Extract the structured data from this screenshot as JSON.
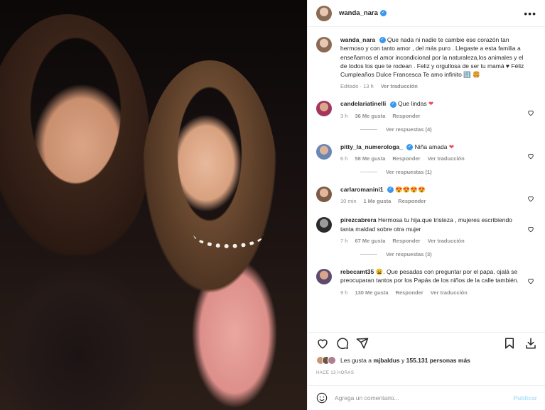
{
  "colors": {
    "verified": "#3897f0",
    "heart_red": "#ed4956",
    "secondary": "#8e8e8e",
    "post_disabled": "#b2dffc"
  },
  "header": {
    "username": "wanda_nara",
    "more_icon": "more-horizontal-icon"
  },
  "caption": {
    "username": "wanda_nara",
    "text": "Que nada ni nadie te cambie ese corazón tan hermoso y con tanto amor , del más puro . Llegaste a esta familia a enseñarnos el amor incondicional por la naturaleza,los animales y el de todos los que te rodean . Feliz y orgullosa de ser tu mamá ♥ Féliz Cumpleaños Dulce Francesca Te amo infinito 🔢 🍔",
    "time": "Editado · 13 h",
    "translate": "Ver traducción"
  },
  "comments": [
    {
      "username": "candelariatinelli",
      "verified": true,
      "text": "Que lindas",
      "emoji": "❤",
      "time": "3 h",
      "likes": "36 Me gusta",
      "reply": "Responder",
      "translate": "",
      "replies": "Ver respuestas (4)"
    },
    {
      "username": "pitty_la_numerologa_",
      "verified": true,
      "text": "Niña amada",
      "emoji": "❤",
      "time": "6 h",
      "likes": "58 Me gusta",
      "reply": "Responder",
      "translate": "Ver traducción",
      "replies": "Ver respuestas (1)"
    },
    {
      "username": "carlaromanini1",
      "verified": true,
      "text": "",
      "emoji": "😍😍😍😍",
      "time": "10 min",
      "likes": "1 Me gusta",
      "reply": "Responder",
      "translate": "",
      "replies": ""
    },
    {
      "username": "pirezcabrera",
      "verified": false,
      "text": "Hermosa tu hija.que tristeza , mujeres escribiendo tanta maldad sobre otra mujer",
      "emoji": "",
      "time": "7 h",
      "likes": "67 Me gusta",
      "reply": "Responder",
      "translate": "Ver traducción",
      "replies": "Ver respuestas (3)"
    },
    {
      "username": "rebecamt35",
      "verified": false,
      "text": "😩. Que pesadas con preguntar por el papa. ojalá se preocuparan tantos por los Papás de los niños de la calle también.",
      "emoji": "",
      "time": "9 h",
      "likes": "130 Me gusta",
      "reply": "Responder",
      "translate": "Ver traducción",
      "replies": ""
    }
  ],
  "actions": {
    "like_icon": "heart-icon",
    "comment_icon": "comment-icon",
    "share_icon": "share-icon",
    "save_icon": "bookmark-icon",
    "download_icon": "download-icon"
  },
  "likes": {
    "prefix": "Les gusta a",
    "user": "mjbaldus",
    "middle": "y",
    "count": "155.131 personas más"
  },
  "posted_ago": "HACE 13 HORAS",
  "compose": {
    "placeholder": "Agrega un comentario...",
    "post_label": "Publicar",
    "emoji_icon": "smiley-icon"
  }
}
